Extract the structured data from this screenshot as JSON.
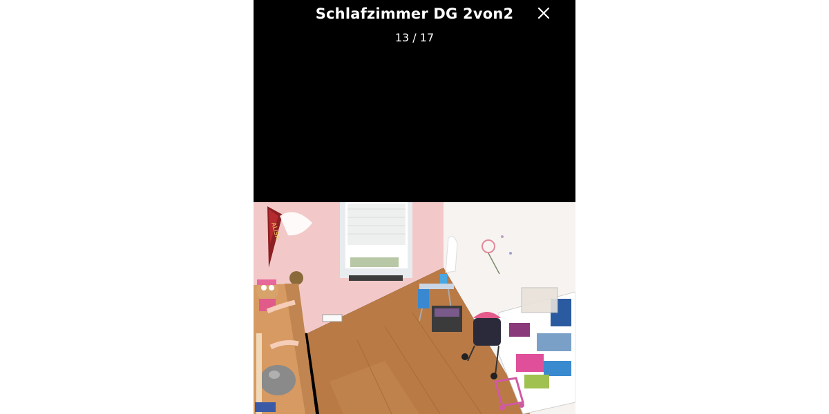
{
  "gallery": {
    "title": "Schlafzimmer DG 2von2",
    "counter": "13 / 17",
    "close_icon": "close-icon",
    "photo": {
      "subject": "room-photo",
      "banner_text": "ALISA"
    }
  },
  "colors": {
    "background": "#000000",
    "text": "#ffffff",
    "page": "#ffffff"
  }
}
